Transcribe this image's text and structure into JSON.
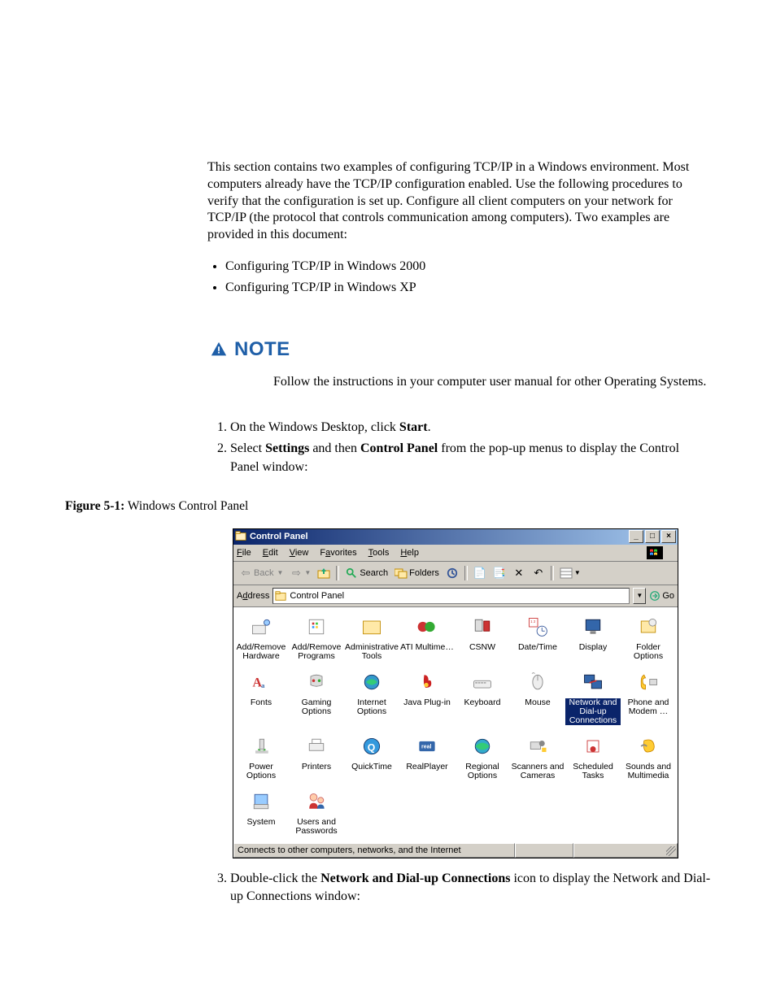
{
  "doc": {
    "intro": "This section contains two examples of configuring TCP/IP in a Windows environment. Most computers already have the TCP/IP configuration enabled. Use the following procedures to verify that the configuration is set up. Configure all client computers on your network for TCP/IP (the protocol that controls communication among computers). Two examples are provided in this document:",
    "bullet1": "Configuring TCP/IP in Windows 2000",
    "bullet2": "Configuring TCP/IP in Windows XP",
    "note_label": "NOTE",
    "note_body": "Follow the instructions in your computer user manual for other Operating Systems.",
    "step1_pre": "On the Windows Desktop, click ",
    "step1_b": "Start",
    "step1_post": ".",
    "step2_pre": "Select ",
    "step2_b1": "Settings",
    "step2_mid": " and then ",
    "step2_b2": "Control Panel",
    "step2_post": " from the pop-up menus to display the Control Panel window:",
    "fig_label": "Figure 5-1:",
    "fig_caption": " Windows Control Panel",
    "step3_pre": "Double-click the ",
    "step3_b": "Network and Dial-up Connections",
    "step3_post": " icon to display the Network and Dial-up Connections window:"
  },
  "cp": {
    "title": "Control Panel",
    "menu": {
      "file": "File",
      "edit": "Edit",
      "view": "View",
      "favorites": "Favorites",
      "tools": "Tools",
      "help": "Help"
    },
    "tb": {
      "back": "Back",
      "search": "Search",
      "folders": "Folders"
    },
    "addr_label": "Address",
    "addr_value": "Control Panel",
    "go": "Go",
    "status": "Connects to other computers, networks, and the Internet",
    "items": [
      "Add/Remove Hardware",
      "Add/Remove Programs",
      "Administrative Tools",
      "ATI Multime…",
      "CSNW",
      "Date/Time",
      "Display",
      "Folder Options",
      "Fonts",
      "Gaming Options",
      "Internet Options",
      "Java Plug-in",
      "Keyboard",
      "Mouse",
      "Network and Dial-up Connections",
      "Phone and Modem …",
      "Power Options",
      "Printers",
      "QuickTime",
      "RealPlayer",
      "Regional Options",
      "Scanners and Cameras",
      "Scheduled Tasks",
      "Sounds and Multimedia",
      "System",
      "Users and Passwords"
    ],
    "selected_index": 14
  }
}
